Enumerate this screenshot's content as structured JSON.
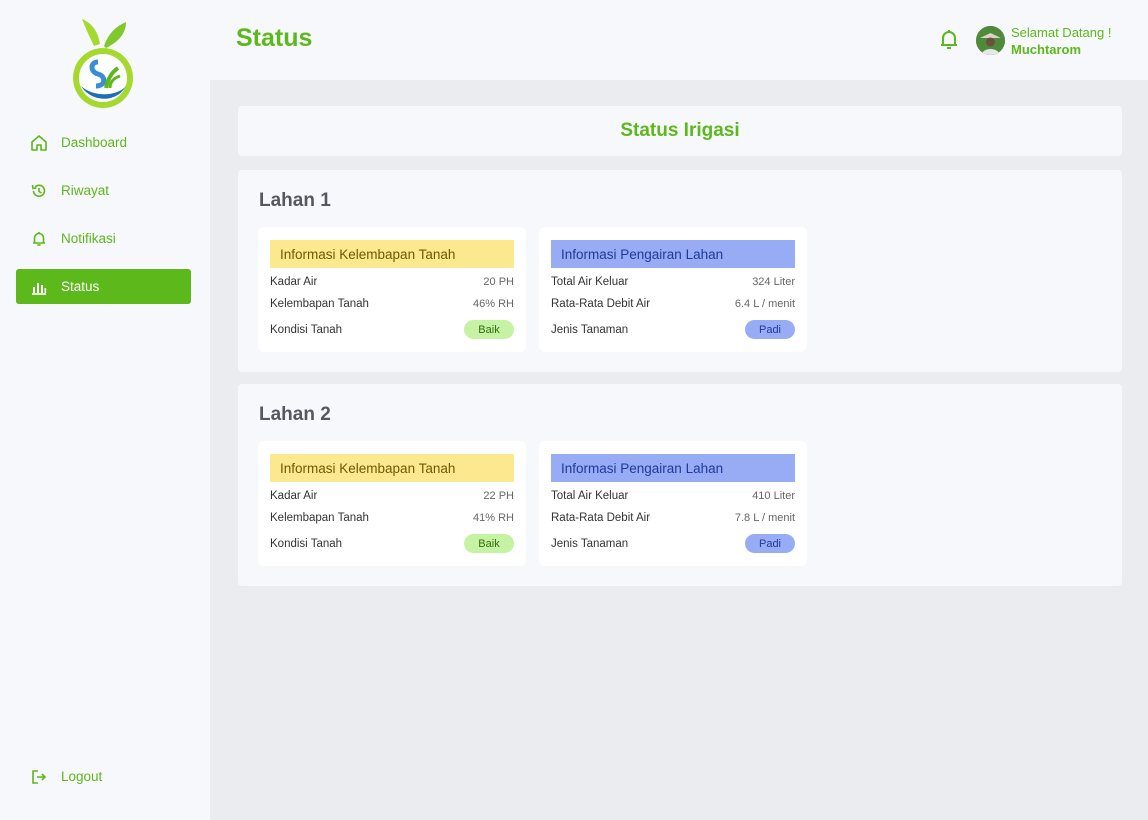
{
  "header": {
    "title": "Status",
    "welcome": "Selamat Datang !",
    "user_name": "Muchtarom"
  },
  "sidebar": {
    "items": [
      {
        "label": "Dashboard",
        "icon": "home-icon"
      },
      {
        "label": "Riwayat",
        "icon": "history-icon"
      },
      {
        "label": "Notifikasi",
        "icon": "bell-icon"
      },
      {
        "label": "Status",
        "icon": "bar-chart-icon",
        "active": true
      }
    ],
    "logout": "Logout"
  },
  "main": {
    "title": "Status Irigasi",
    "lahan": [
      {
        "title": "Lahan 1",
        "moisture": {
          "header": "Informasi Kelembapan Tanah",
          "kadar_air_label": "Kadar Air",
          "kadar_air": "20 PH",
          "kelembapan_label": "Kelembapan Tanah",
          "kelembapan": "46% RH",
          "kondisi_label": "Kondisi Tanah",
          "kondisi": "Baik"
        },
        "irrigation": {
          "header": "Informasi Pengairan Lahan",
          "total_label": "Total Air Keluar",
          "total": "324 Liter",
          "debit_label": "Rata-Rata Debit Air",
          "debit": "6.4 L / menit",
          "tanaman_label": "Jenis Tanaman",
          "tanaman": "Padi"
        }
      },
      {
        "title": "Lahan 2",
        "moisture": {
          "header": "Informasi Kelembapan Tanah",
          "kadar_air_label": "Kadar Air",
          "kadar_air": "22 PH",
          "kelembapan_label": "Kelembapan Tanah",
          "kelembapan": "41% RH",
          "kondisi_label": "Kondisi Tanah",
          "kondisi": "Baik"
        },
        "irrigation": {
          "header": "Informasi Pengairan Lahan",
          "total_label": "Total Air Keluar",
          "total": "410 Liter",
          "debit_label": "Rata-Rata Debit Air",
          "debit": "7.8 L / menit",
          "tanaman_label": "Jenis Tanaman",
          "tanaman": "Padi"
        }
      }
    ]
  },
  "colors": {
    "brand": "#5cb81b",
    "yellow": "#fce98f",
    "blue": "#97acf4",
    "badge_green": "#c5f2a3"
  }
}
